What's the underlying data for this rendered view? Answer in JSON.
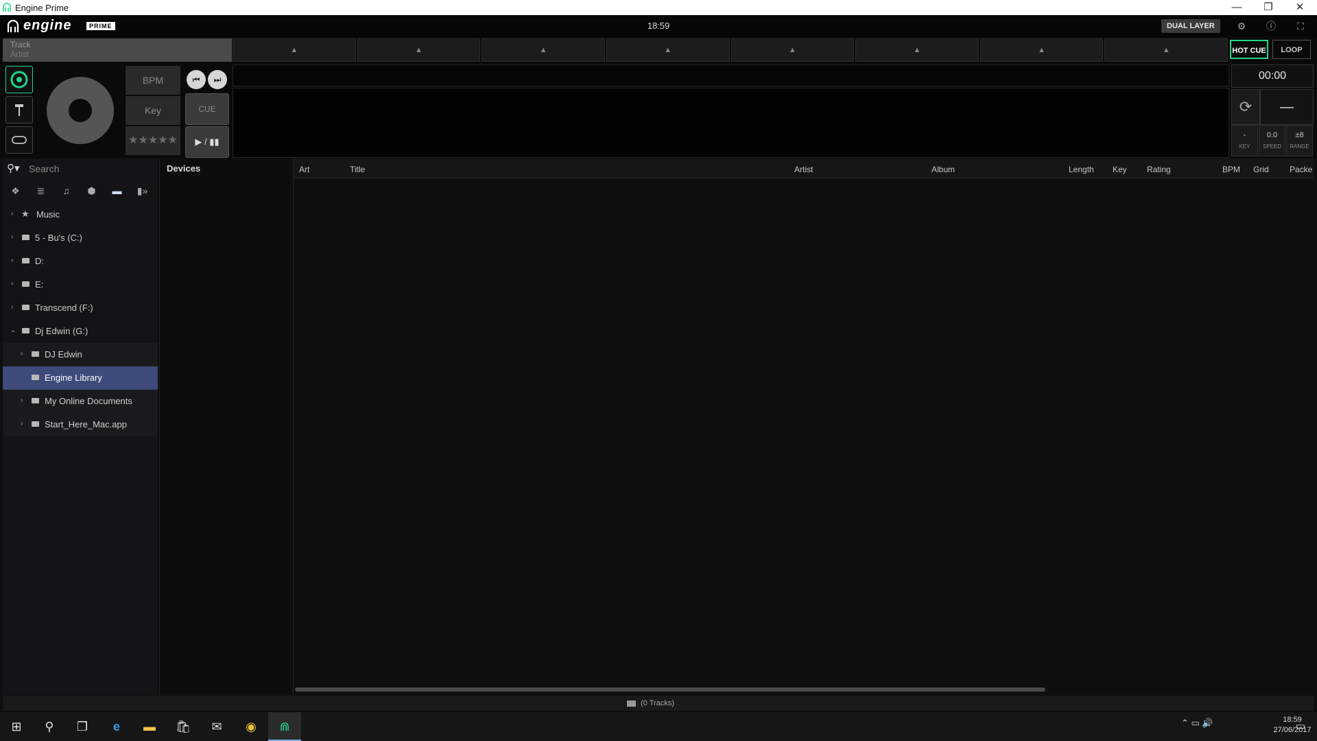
{
  "window": {
    "title": "Engine Prime",
    "min": "—",
    "restore": "❐",
    "close": "✕"
  },
  "header": {
    "logo_word": "engine",
    "logo_prime": "PRIME",
    "clock": "18:59",
    "dual_layer": "DUAL LAYER",
    "icons": [
      "gear-icon",
      "info-icon",
      "fullscreen-icon"
    ]
  },
  "deck": {
    "track": "Track",
    "artist": "Artist",
    "bpm": "BPM",
    "key": "Key",
    "stars": "★★★★★",
    "prev": "⏮",
    "next": "⏭",
    "cue": "CUE",
    "play": "▶ / ▮▮",
    "hot_cue": "HOT CUE",
    "loop": "LOOP",
    "time": "00:00",
    "minus": "—",
    "key_value": "-",
    "key_label": "KEY",
    "speed_value": "0.0",
    "speed_label": "SPEED",
    "range_value": "±8",
    "range_label": "RANGE",
    "pad_count": 8,
    "accent": "#1fd68a"
  },
  "library": {
    "search_placeholder": "Search",
    "devices_header": "Devices",
    "columns": [
      "Art",
      "Title",
      "Artist",
      "Album",
      "Length",
      "Key",
      "Rating",
      "BPM",
      "Grid",
      "Packe"
    ],
    "tree": [
      {
        "label": "Music",
        "level": 0,
        "icon": "star-icon"
      },
      {
        "label": "5 - Bu's (C:)",
        "level": 0,
        "icon": "folder-icon"
      },
      {
        "label": "D:",
        "level": 0,
        "icon": "folder-icon"
      },
      {
        "label": "E:",
        "level": 0,
        "icon": "folder-icon"
      },
      {
        "label": "Transcend (F:)",
        "level": 0,
        "icon": "folder-icon"
      },
      {
        "label": "Dj Edwin (G:)",
        "level": 0,
        "icon": "folder-icon",
        "expanded": true
      },
      {
        "label": "DJ Edwin",
        "level": 1,
        "icon": "folder-icon"
      },
      {
        "label": "Engine Library",
        "level": 1,
        "icon": "folder-icon",
        "selected": true
      },
      {
        "label": "My Online Documents",
        "level": 1,
        "icon": "folder-icon"
      },
      {
        "label": "Start_Here_Mac.app",
        "level": 1,
        "icon": "folder-icon"
      }
    ],
    "status": "(0 Tracks)"
  },
  "taskbar": {
    "time": "18:59",
    "date": "27/06/2017"
  }
}
